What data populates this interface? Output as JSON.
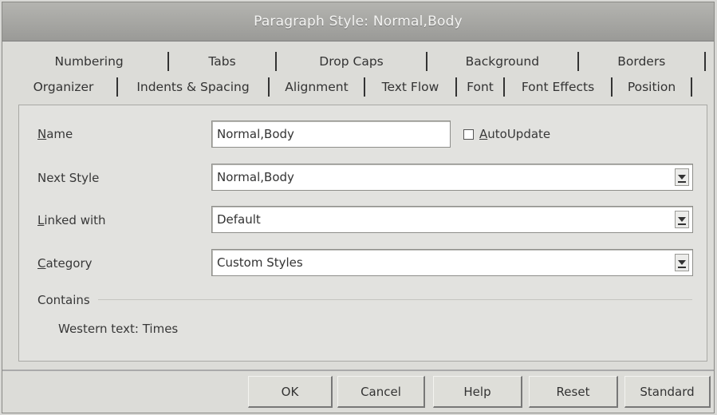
{
  "window": {
    "title": "Paragraph Style: Normal,Body"
  },
  "tabs": {
    "row1": [
      "Numbering",
      "Tabs",
      "Drop Caps",
      "Background",
      "Borders"
    ],
    "row2": [
      "Organizer",
      "Indents & Spacing",
      "Alignment",
      "Text Flow",
      "Font",
      "Font Effects",
      "Position"
    ]
  },
  "form": {
    "name_label": "Name",
    "name_value": "Normal,Body",
    "autoupdate_label": "AutoUpdate",
    "autoupdate_checked": false,
    "next_style_label": "Next Style",
    "next_style_value": "Normal,Body",
    "linked_with_label": "Linked with",
    "linked_with_value": "Default",
    "category_label": "Category",
    "category_value": "Custom Styles",
    "contains_label": "Contains",
    "contains_value": "Western text: Times"
  },
  "buttons": {
    "ok": "OK",
    "cancel": "Cancel",
    "help": "Help",
    "reset": "Reset",
    "standard": "Standard"
  }
}
